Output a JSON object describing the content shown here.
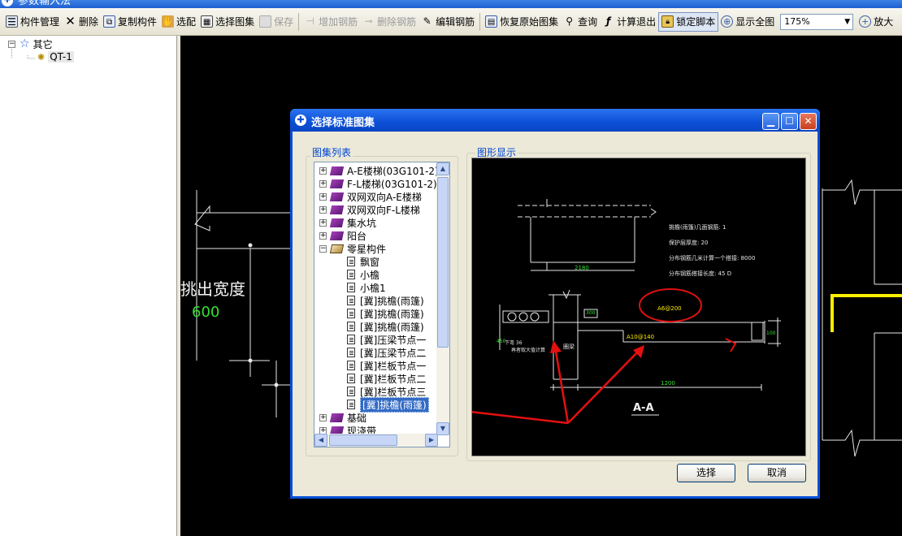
{
  "window": {
    "title": "参数输入法"
  },
  "toolbar": {
    "items": [
      {
        "label": "构件管理",
        "icon": "component-manager-icon",
        "disabled": false
      },
      {
        "label": "删除",
        "icon": "delete-x-icon",
        "disabled": false
      },
      {
        "label": "复制构件",
        "icon": "copy-icon",
        "disabled": false
      },
      {
        "label": "选配",
        "icon": "select-match-icon",
        "disabled": false
      },
      {
        "label": "选择图集",
        "icon": "atlas-icon",
        "disabled": false
      },
      {
        "label": "保存",
        "icon": "save-icon",
        "disabled": true
      },
      {
        "label": "增加钢筋",
        "icon": "add-rebar-icon",
        "disabled": true
      },
      {
        "label": "删除钢筋",
        "icon": "remove-rebar-icon",
        "disabled": true
      },
      {
        "label": "编辑钢筋",
        "icon": "edit-rebar-icon",
        "disabled": false
      },
      {
        "label": "恢复原始图集",
        "icon": "restore-icon",
        "disabled": false
      },
      {
        "label": "查询",
        "icon": "query-icon",
        "disabled": false
      },
      {
        "label": "计算退出",
        "icon": "calc-exit-icon",
        "disabled": false
      },
      {
        "label": "锁定脚本",
        "icon": "lock-icon",
        "disabled": false
      },
      {
        "label": "显示全图",
        "icon": "fit-view-icon",
        "disabled": false
      }
    ],
    "zoom_value": "175%",
    "zoom_in_label": "放大"
  },
  "left_tree": {
    "root": "其它",
    "child": "QT-1"
  },
  "canvas": {
    "overhang_label": "挑出宽度",
    "overhang_value": "600"
  },
  "dialog": {
    "title": "选择标准图集",
    "list_group_label": "图集列表",
    "preview_group_label": "图形显示",
    "ok_label": "选择",
    "cancel_label": "取消",
    "tree": [
      {
        "label": "A-E楼梯(03G101-2)",
        "type": "book",
        "level": 0,
        "expander": "+"
      },
      {
        "label": "F-L楼梯(03G101-2)",
        "type": "book",
        "level": 0,
        "expander": "+"
      },
      {
        "label": "双网双向A-E楼梯",
        "type": "book",
        "level": 0,
        "expander": "+"
      },
      {
        "label": "双网双向F-L楼梯",
        "type": "book",
        "level": 0,
        "expander": "+"
      },
      {
        "label": "集水坑",
        "type": "book",
        "level": 0,
        "expander": "+"
      },
      {
        "label": "阳台",
        "type": "book",
        "level": 0,
        "expander": "+"
      },
      {
        "label": "零星构件",
        "type": "book-open",
        "level": 0,
        "expander": "−"
      },
      {
        "label": "飘窗",
        "type": "doc",
        "level": 1
      },
      {
        "label": "小檐",
        "type": "doc",
        "level": 1
      },
      {
        "label": "小檐1",
        "type": "doc",
        "level": 1
      },
      {
        "label": "[冀]挑檐(雨篷)",
        "type": "doc",
        "level": 1
      },
      {
        "label": "[冀]挑檐(雨篷)",
        "type": "doc",
        "level": 1
      },
      {
        "label": "[冀]挑檐(雨篷)",
        "type": "doc",
        "level": 1
      },
      {
        "label": "[冀]压梁节点一",
        "type": "doc",
        "level": 1
      },
      {
        "label": "[冀]压梁节点二",
        "type": "doc",
        "level": 1
      },
      {
        "label": "[冀]栏板节点一",
        "type": "doc",
        "level": 1
      },
      {
        "label": "[冀]栏板节点二",
        "type": "doc",
        "level": 1
      },
      {
        "label": "[冀]栏板节点三",
        "type": "doc",
        "level": 1
      },
      {
        "label": "[冀]挑檐(雨篷)",
        "type": "doc",
        "level": 1,
        "selected": true
      },
      {
        "label": "基础",
        "type": "book",
        "level": 0,
        "expander": "+"
      },
      {
        "label": "现浇带",
        "type": "book",
        "level": 0,
        "expander": "+"
      }
    ],
    "preview": {
      "info_lines": [
        "挑檐(雨篷)几面钢筋: 1",
        "保护层厚度: 20",
        "分布钢筋几米计算一个搭接: 8000",
        "分布钢筋搭接长度: 45 D"
      ],
      "dim_top": "2180",
      "dim_bottom": "1200",
      "dim_left": "300",
      "dim_small": "100",
      "dim_side": "450",
      "rebar_top": "A6@200",
      "rebar_bottom": "A10@140",
      "beam_label": "圈梁",
      "note_line1": "下弯 36",
      "note_line2": "再者取大值计算",
      "section_label": "A-A"
    }
  }
}
